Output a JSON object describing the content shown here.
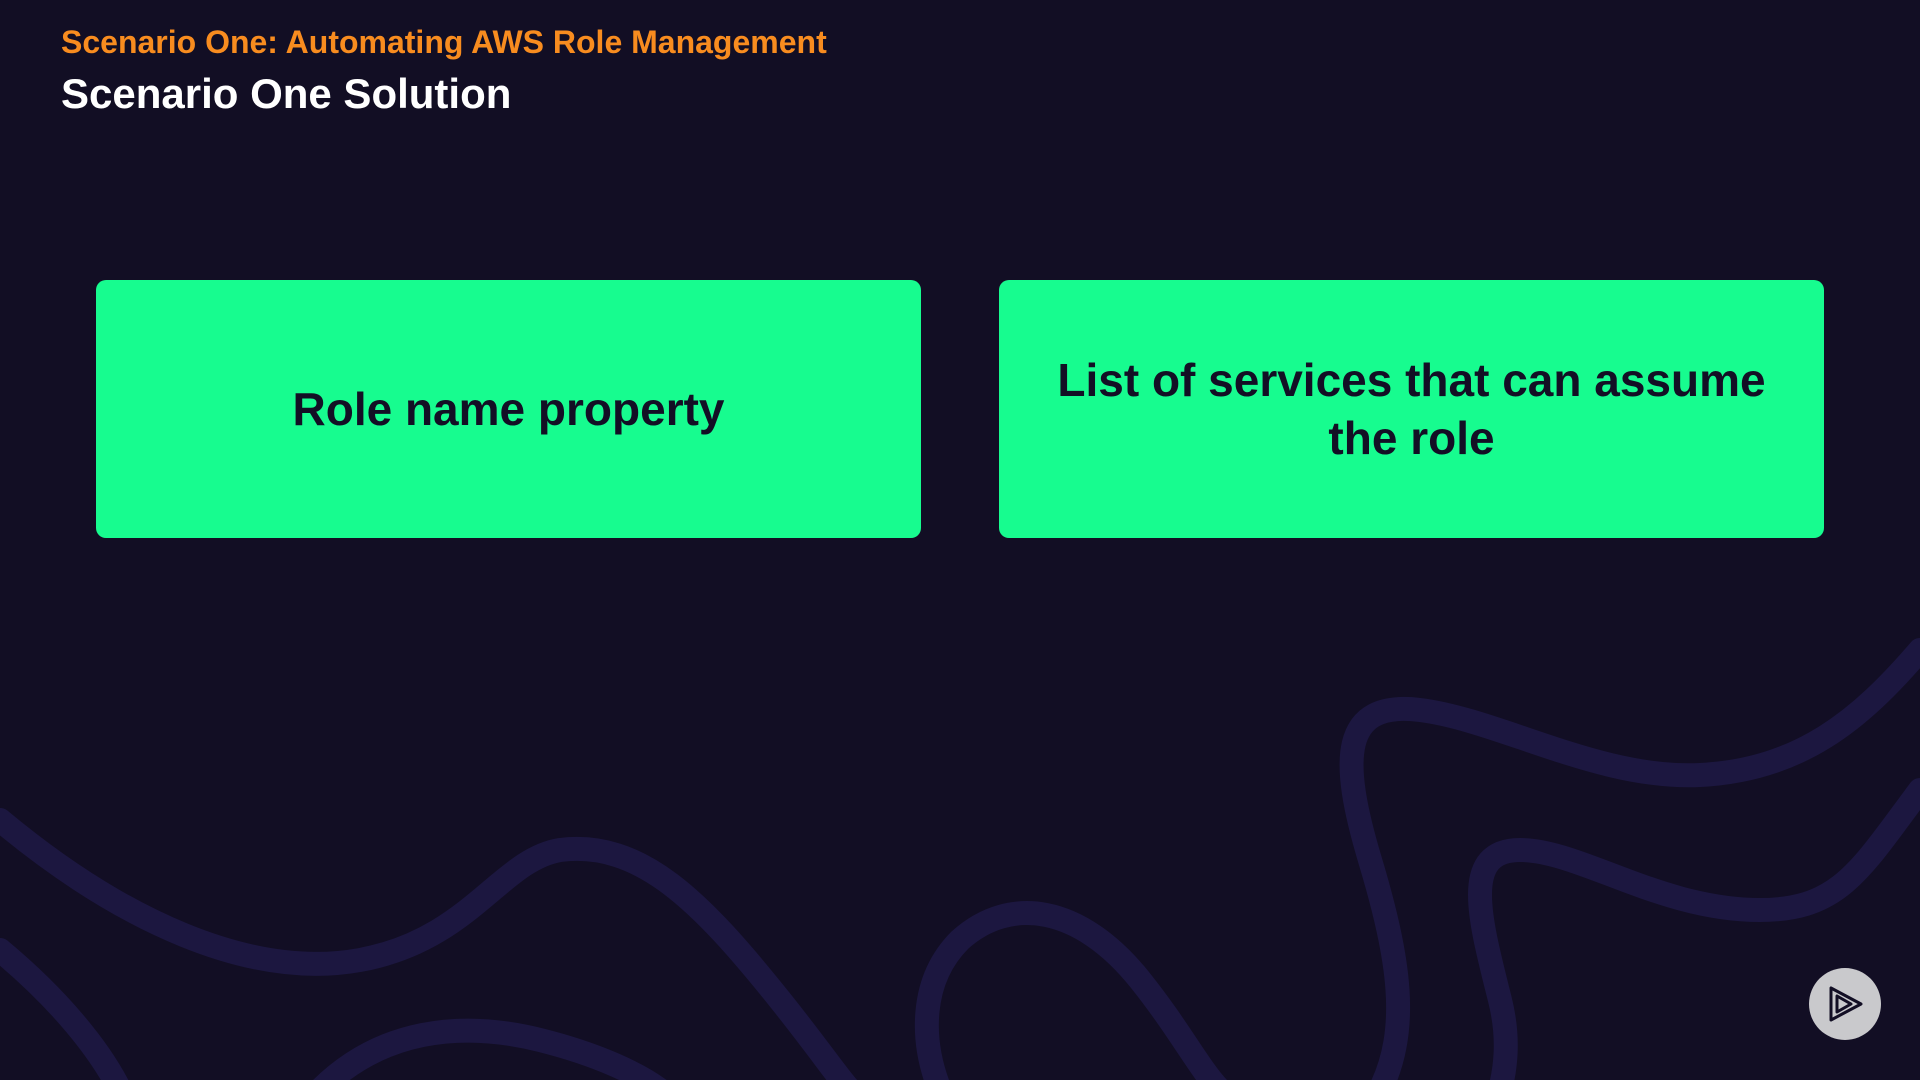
{
  "slide": {
    "eyebrow": "Scenario One: Automating AWS Role Management",
    "title": "Scenario One Solution",
    "cards": [
      {
        "label": "Role name property"
      },
      {
        "label": "List of services that can assume the role"
      }
    ]
  },
  "colors": {
    "background": "#120e24",
    "eyebrow": "#f88c1f",
    "title": "#ffffff",
    "card": "#17fc8f",
    "card_text": "#130f25",
    "contour": "#1c1740",
    "logo_bg": "#c9c9cc"
  },
  "icons": {
    "logo": "play-logo-icon"
  }
}
